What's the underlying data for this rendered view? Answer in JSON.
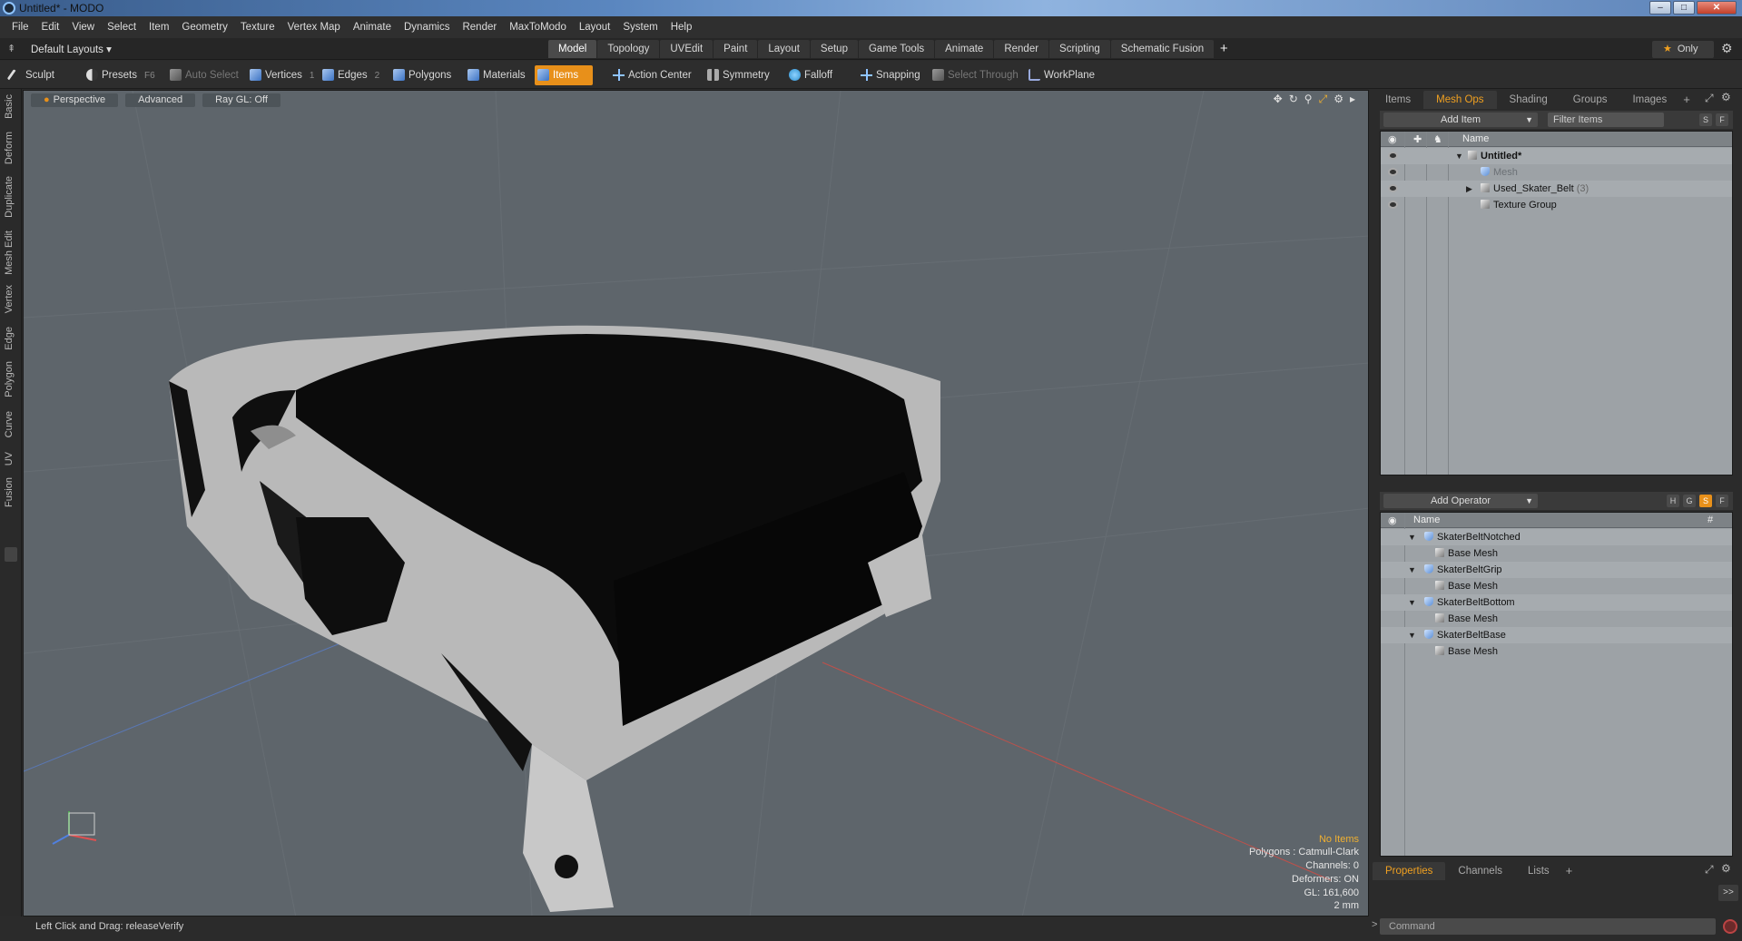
{
  "window": {
    "title": "Untitled* - MODO",
    "min": "–",
    "max": "□",
    "close": "✕"
  },
  "menu": [
    "File",
    "Edit",
    "View",
    "Select",
    "Item",
    "Geometry",
    "Texture",
    "Vertex Map",
    "Animate",
    "Dynamics",
    "Render",
    "MaxToModo",
    "Layout",
    "System",
    "Help"
  ],
  "layout": {
    "selector": "Default Layouts ▾",
    "tabs": [
      "Model",
      "Topology",
      "UVEdit",
      "Paint",
      "Layout",
      "Setup",
      "Game Tools",
      "Animate",
      "Render",
      "Scripting",
      "Schematic Fusion"
    ],
    "active_tab": "Model",
    "add": "+",
    "only": "Only"
  },
  "toolbar": {
    "sculpt": "Sculpt",
    "presets": "Presets",
    "presets_key": "F6",
    "auto_select": "Auto Select",
    "vertices": "Vertices",
    "vertices_key": "1",
    "edges": "Edges",
    "edges_key": "2",
    "polygons": "Polygons",
    "materials": "Materials",
    "items": "Items",
    "action_center": "Action Center",
    "symmetry": "Symmetry",
    "falloff": "Falloff",
    "snapping": "Snapping",
    "select_through": "Select Through",
    "workplane": "WorkPlane"
  },
  "left_tabs": [
    "Basic",
    "Deform",
    "Duplicate",
    "Mesh Edit",
    "Vertex",
    "Edge",
    "Polygon",
    "Curve",
    "UV",
    "Fusion"
  ],
  "viewport": {
    "view": "Perspective",
    "advanced": "Advanced",
    "raygl": "Ray GL: Off",
    "stats": {
      "no_items": "No Items",
      "polygons": "Polygons : Catmull-Clark",
      "channels": "Channels: 0",
      "deformers": "Deformers: ON",
      "gl": "GL: 161,600",
      "scale": "2 mm"
    }
  },
  "status": "Left Click and Drag:   releaseVerify",
  "items_panel": {
    "tabs": [
      "Items",
      "Mesh Ops",
      "Shading",
      "Groups",
      "Images"
    ],
    "active_tab": "Mesh Ops",
    "add_item": "Add Item",
    "filter": "Filter Items",
    "s_label": "S",
    "f_label": "F",
    "name_header": "Name",
    "rows": [
      {
        "label": "Untitled*",
        "bold": true
      },
      {
        "label": "Mesh",
        "dim": true
      },
      {
        "label": "Used_Skater_Belt",
        "count": "(3)"
      },
      {
        "label": "Texture Group"
      }
    ]
  },
  "meshops_panel": {
    "add_operator": "Add Operator",
    "h": "H",
    "g": "G",
    "s": "S",
    "f": "F",
    "name_header": "Name",
    "hash": "#",
    "rows": [
      {
        "label": "SkaterBeltNotched",
        "child": "Base Mesh"
      },
      {
        "label": "SkaterBeltGrip",
        "child": "Base Mesh"
      },
      {
        "label": "SkaterBeltBottom",
        "child": "Base Mesh"
      },
      {
        "label": "SkaterBeltBase",
        "child": "Base Mesh"
      }
    ]
  },
  "properties_panel": {
    "tabs": [
      "Properties",
      "Channels",
      "Lists"
    ],
    "active_tab": "Properties",
    "arrow": ">>"
  },
  "command": {
    "prompt": ">",
    "placeholder": "Command"
  },
  "colors": {
    "accent": "#e8901a",
    "viewport_bg": "#5e656b",
    "panel_bg": "#9da2a6"
  }
}
